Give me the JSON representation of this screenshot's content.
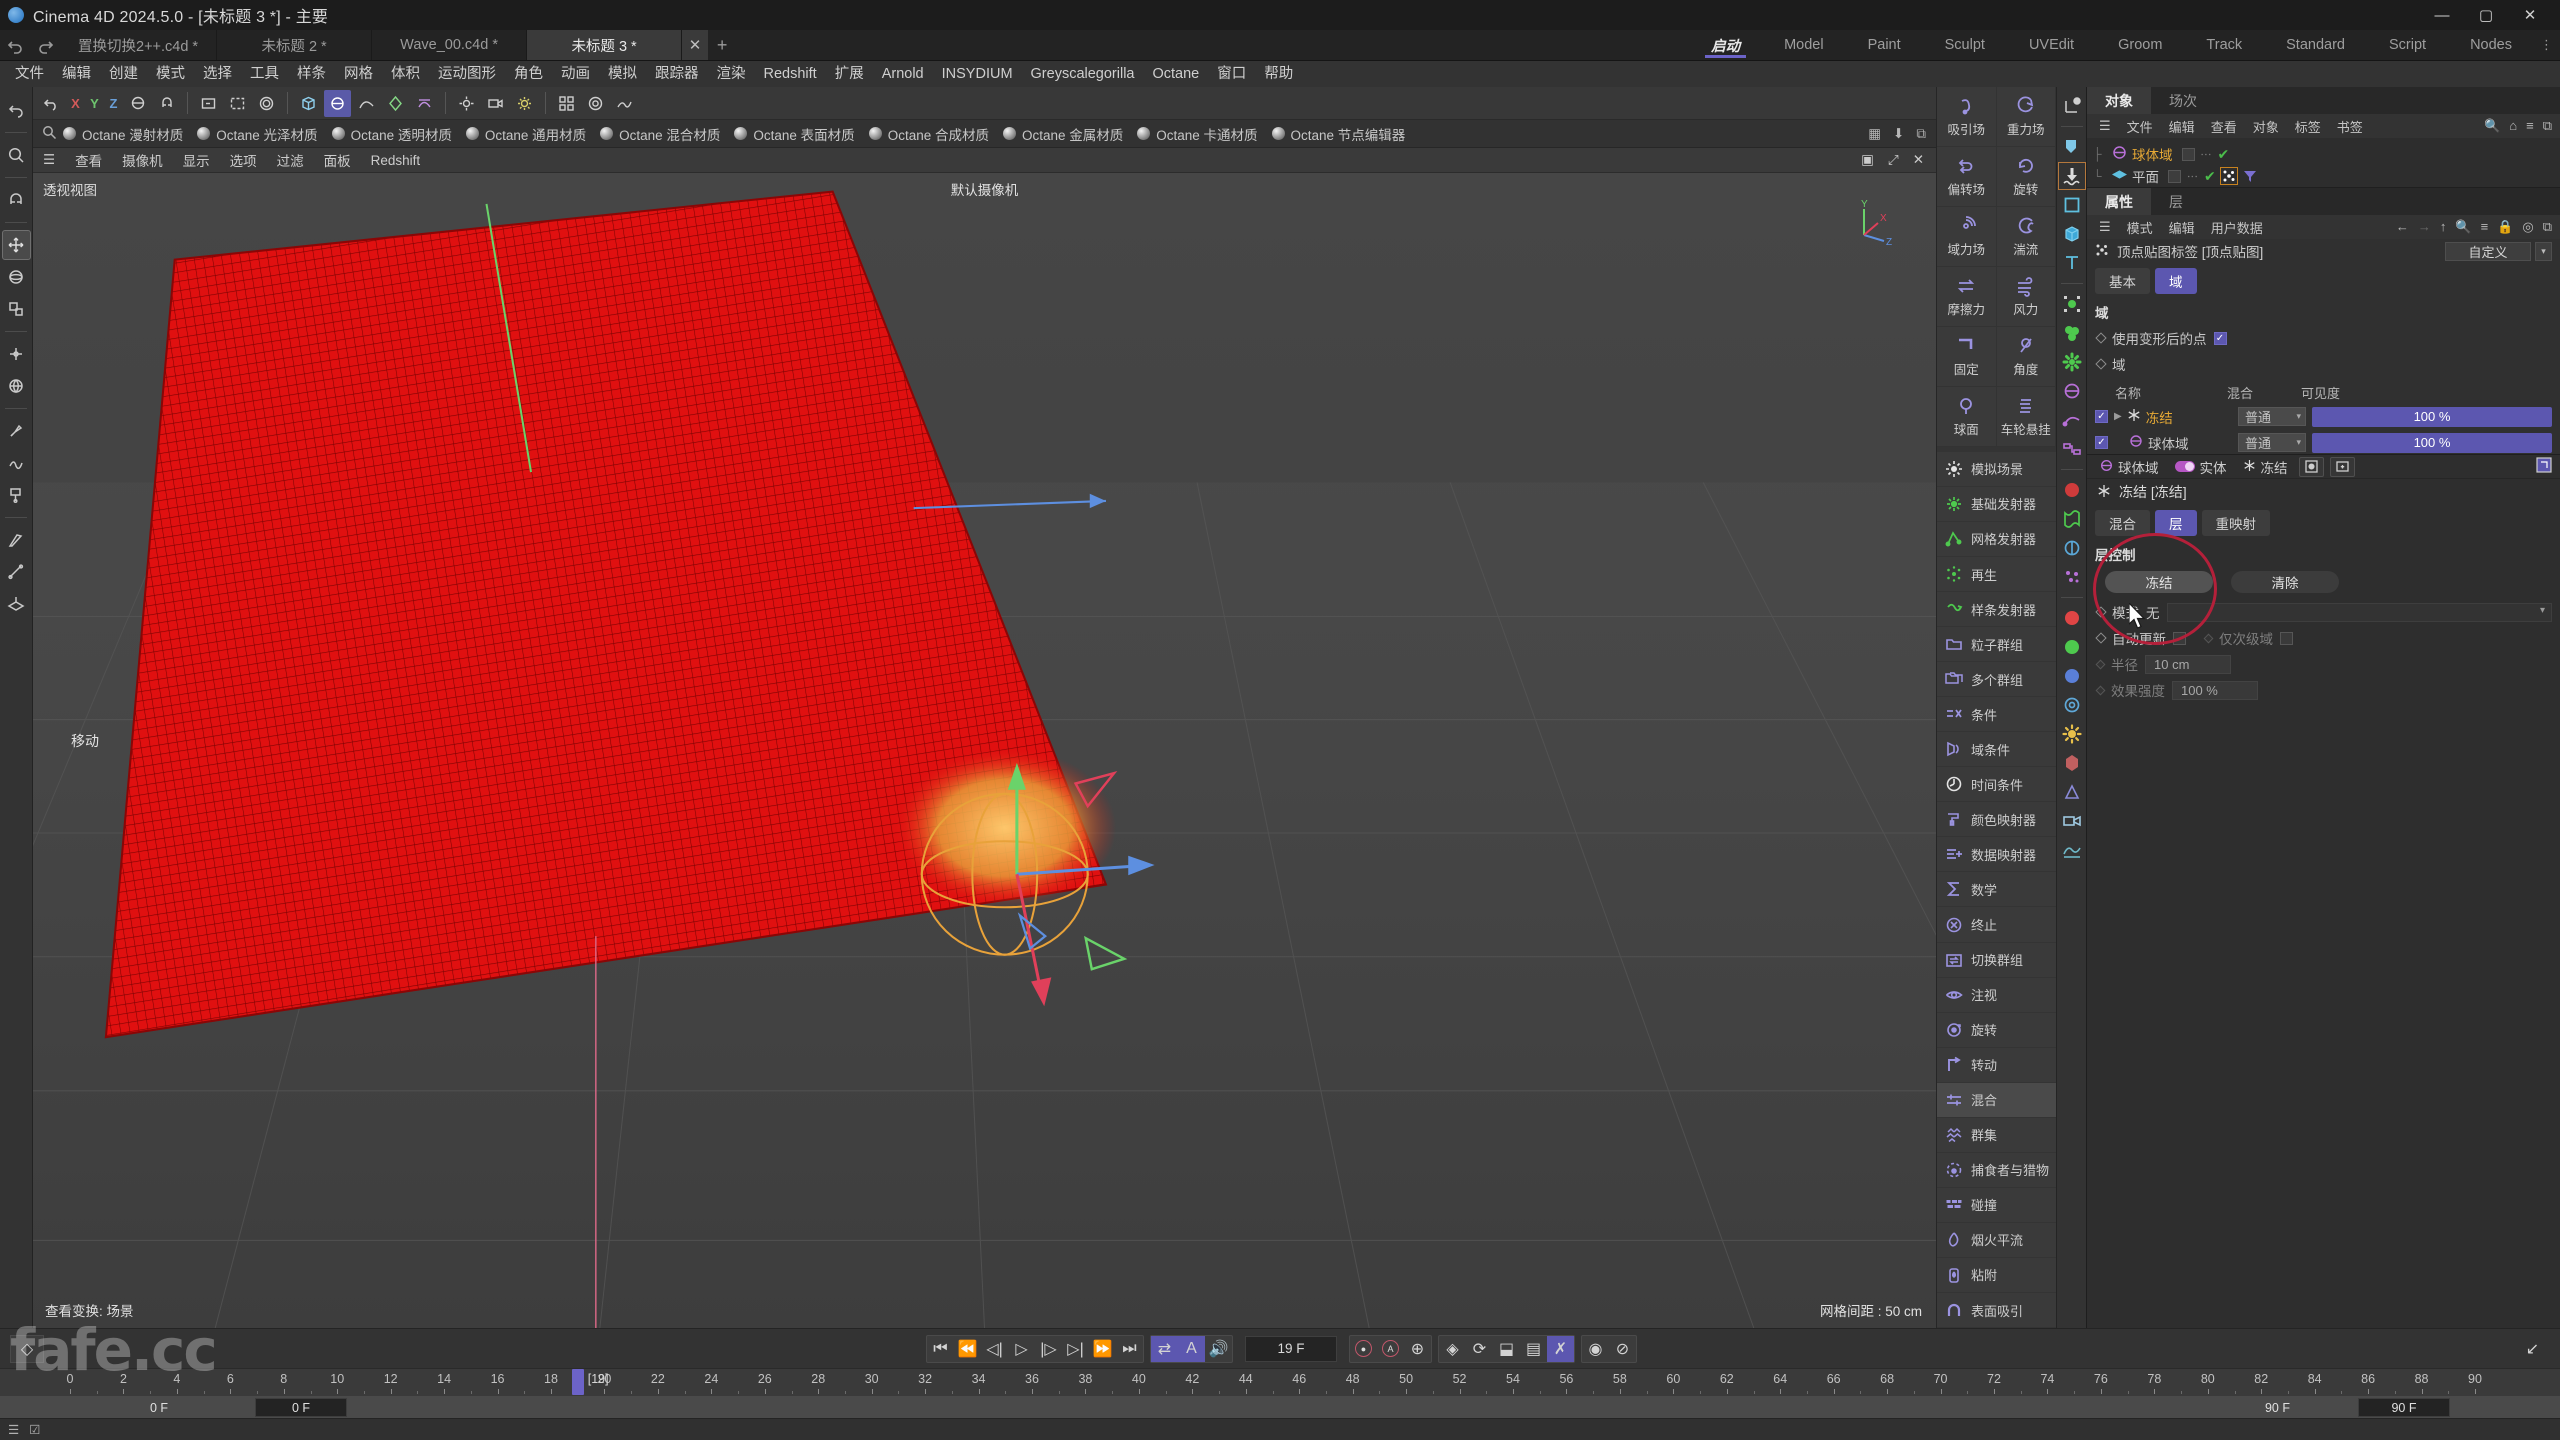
{
  "window": {
    "title": "Cinema 4D 2024.5.0 - [未标题 3 *] - 主要",
    "minimize": "—",
    "maximize": "▢",
    "close": "✕"
  },
  "doc_tabs": [
    {
      "label": "置换切换2++.c4d *",
      "active": false
    },
    {
      "label": "未标题 2 *",
      "active": false
    },
    {
      "label": "Wave_00.c4d *",
      "active": false
    },
    {
      "label": "未标题 3 *",
      "active": true
    }
  ],
  "doc_tab_close": "✕",
  "doc_tab_add": "+",
  "layout_tabs": [
    {
      "label": "启动",
      "active": true
    },
    {
      "label": "Model",
      "active": false
    },
    {
      "label": "Paint",
      "active": false
    },
    {
      "label": "Sculpt",
      "active": false
    },
    {
      "label": "UVEdit",
      "active": false
    },
    {
      "label": "Groom",
      "active": false
    },
    {
      "label": "Track",
      "active": false
    },
    {
      "label": "Standard",
      "active": false
    },
    {
      "label": "Script",
      "active": false
    },
    {
      "label": "Nodes",
      "active": false
    }
  ],
  "menubar": [
    "文件",
    "编辑",
    "创建",
    "模式",
    "选择",
    "工具",
    "样条",
    "网格",
    "体积",
    "运动图形",
    "角色",
    "动画",
    "模拟",
    "跟踪器",
    "渲染",
    "Redshift",
    "扩展",
    "Arnold",
    "INSYDIUM",
    "Greyscalegorilla",
    "Octane",
    "窗口",
    "帮助"
  ],
  "axis_buttons": [
    "X",
    "Y",
    "Z"
  ],
  "material_bar": {
    "items": [
      "Octane 漫射材质",
      "Octane 光泽材质",
      "Octane 透明材质",
      "Octane 通用材质",
      "Octane 混合材质",
      "Octane 表面材质",
      "Octane 合成材质",
      "Octane 金属材质",
      "Octane 卡通材质",
      "Octane 节点编辑器"
    ]
  },
  "viewport_menu": [
    "查看",
    "摄像机",
    "显示",
    "选项",
    "过滤",
    "面板",
    "Redshift"
  ],
  "viewport": {
    "label_topleft": "透视视图",
    "label_topcenter": "默认摄像机",
    "label_bottomleft": "查看变换: 场景",
    "grid_spacing": "网格间距 : 50 cm",
    "tool_hint": "移动",
    "axis_x": "X",
    "axis_y": "Y",
    "axis_z": "Z",
    "plane_color": "#e01010",
    "field_color": "#e8a23a"
  },
  "sim_fields": {
    "cells": [
      {
        "label": "吸引场"
      },
      {
        "label": "重力场"
      },
      {
        "label": "偏转场"
      },
      {
        "label": "旋转"
      },
      {
        "label": "域力场"
      },
      {
        "label": "湍流"
      },
      {
        "label": "摩擦力"
      },
      {
        "label": "风力"
      },
      {
        "label": "固定"
      },
      {
        "label": "角度"
      },
      {
        "label": "球面"
      },
      {
        "label": "车轮悬挂"
      }
    ]
  },
  "sim_list": [
    {
      "label": "模拟场景",
      "icon": "gear-icon",
      "color": "#e4e4e4"
    },
    {
      "label": "基础发射器",
      "icon": "emitter-icon",
      "color": "#4ec94e"
    },
    {
      "label": "网格发射器",
      "icon": "mesh-emitter-icon",
      "color": "#4ec94e"
    },
    {
      "label": "再生",
      "icon": "regen-icon",
      "color": "#4ec94e"
    },
    {
      "label": "样条发射器",
      "icon": "spline-emitter-icon",
      "color": "#4ec94e"
    },
    {
      "label": "粒子群组",
      "icon": "folder-icon",
      "color": "#9b93e0"
    },
    {
      "label": "多个群组",
      "icon": "folders-icon",
      "color": "#9b93e0"
    },
    {
      "label": "条件",
      "icon": "condition-icon",
      "color": "#9b93e0"
    },
    {
      "label": "域条件",
      "icon": "field-condition-icon",
      "color": "#9b93e0"
    },
    {
      "label": "时间条件",
      "icon": "time-condition-icon",
      "color": "#e4e4e4"
    },
    {
      "label": "颜色映射器",
      "icon": "color-mapper-icon",
      "color": "#9b93e0"
    },
    {
      "label": "数据映射器",
      "icon": "data-mapper-icon",
      "color": "#9b93e0"
    },
    {
      "label": "数学",
      "icon": "sigma-icon",
      "color": "#9b93e0"
    },
    {
      "label": "终止",
      "icon": "terminate-icon",
      "color": "#9b93e0"
    },
    {
      "label": "切换群组",
      "icon": "switch-group-icon",
      "color": "#9b93e0"
    },
    {
      "label": "注视",
      "icon": "eye-icon",
      "color": "#9b93e0"
    },
    {
      "label": "旋转",
      "icon": "rotate-icon",
      "color": "#9b93e0"
    },
    {
      "label": "转动",
      "icon": "turn-icon",
      "color": "#9b93e0"
    },
    {
      "label": "混合",
      "icon": "blend-icon",
      "color": "#9b93e0",
      "highlight": true
    },
    {
      "label": "群集",
      "icon": "flock-icon",
      "color": "#9b93e0"
    },
    {
      "label": "捕食者与猎物",
      "icon": "predator-prey-icon",
      "color": "#9b93e0"
    },
    {
      "label": "碰撞",
      "icon": "collision-icon",
      "color": "#9b93e0"
    },
    {
      "label": "烟火平流",
      "icon": "pyro-advect-icon",
      "color": "#9b93e0"
    },
    {
      "label": "粘附",
      "icon": "stick-icon",
      "color": "#9b93e0"
    },
    {
      "label": "表面吸引",
      "icon": "surface-attract-icon",
      "color": "#9b93e0"
    }
  ],
  "object_manager": {
    "tabs": [
      {
        "label": "对象",
        "active": true
      },
      {
        "label": "场次",
        "active": false
      }
    ],
    "menu": [
      "文件",
      "编辑",
      "查看",
      "对象",
      "标签",
      "书签"
    ],
    "right_icons": [
      "search-icon",
      "home-icon",
      "filter-icon",
      "popout-icon"
    ],
    "rows": [
      {
        "name": "球体域",
        "selected": true,
        "icon": "sphere-field-icon",
        "check": "✔",
        "tags": []
      },
      {
        "name": "平面",
        "selected": false,
        "icon": "plane-icon",
        "check": "✔",
        "tags": [
          "vertex-map-tag",
          "field-tag"
        ]
      }
    ]
  },
  "attributes": {
    "tabs": [
      {
        "label": "属性",
        "active": true
      },
      {
        "label": "层",
        "active": false
      }
    ],
    "menu": [
      "模式",
      "编辑",
      "用户数据"
    ],
    "right_icons": [
      "back-icon",
      "forward-icon",
      "up-icon",
      "search-icon",
      "filter-icon",
      "lock-icon",
      "target-icon",
      "popout-icon"
    ],
    "header_title": "顶点贴图标签 [顶点贴图]",
    "preset": "自定义",
    "segments": [
      {
        "label": "基本",
        "on": false
      },
      {
        "label": "域",
        "on": true
      }
    ],
    "section_title": "域",
    "use_deformed_points": {
      "label": "使用变形后的点",
      "checked": true
    },
    "field_label": "域",
    "table_headers": {
      "name": "名称",
      "blend": "混合",
      "visibility": "可见度"
    },
    "table_rows": [
      {
        "enabled": true,
        "name": "冻结",
        "icon": "freeze-icon",
        "selected": true,
        "blend": "普通",
        "visibility": "100 %",
        "expandable": true
      },
      {
        "enabled": true,
        "name": "球体域",
        "icon": "sphere-field-icon",
        "selected": false,
        "blend": "普通",
        "visibility": "100 %",
        "expandable": false
      }
    ]
  },
  "object_props": {
    "breadcrumb": [
      {
        "label": "球体域",
        "icon": "sphere-field-icon"
      },
      {
        "label": "实体",
        "icon": "toggle-pill"
      },
      {
        "label": "冻结",
        "icon": "freeze-icon"
      }
    ],
    "breadcrumb_buttons": [
      "target-icon",
      "new-folder-icon"
    ],
    "breadcrumb_right": "popout-icon",
    "title": "冻结 [冻结]",
    "title_icon": "freeze-icon",
    "segments": [
      {
        "label": "混合",
        "on": false
      },
      {
        "label": "层",
        "on": true
      },
      {
        "label": "重映射",
        "on": false
      }
    ],
    "section_title": "层控制",
    "buttons": [
      {
        "label": "冻结",
        "primary": true
      },
      {
        "label": "清除",
        "primary": false
      }
    ],
    "rows": [
      {
        "label": "模式",
        "value": "无",
        "type": "dropdown"
      },
      {
        "label": "自动更新",
        "value": "",
        "type": "checkbox",
        "checked": false,
        "extra_label": "仅次级域",
        "extra_checked": false
      },
      {
        "label": "半径",
        "value": "10 cm",
        "type": "number",
        "dim": true
      },
      {
        "label": "效果强度",
        "value": "100 %",
        "type": "number",
        "dim": true
      }
    ]
  },
  "timeline": {
    "current_frame": "19 F",
    "start_frame": "0 F",
    "preview_start": "0 F",
    "end_frame": "90 F",
    "preview_end": "90 F",
    "playhead_label": "[19]",
    "playhead_frame": 19,
    "min": 0,
    "max": 90,
    "ticks": [
      0,
      2,
      4,
      6,
      8,
      10,
      12,
      14,
      16,
      18,
      20,
      22,
      24,
      26,
      28,
      30,
      32,
      34,
      36,
      38,
      40,
      42,
      44,
      46,
      48,
      50,
      52,
      54,
      56,
      58,
      60,
      62,
      64,
      66,
      68,
      70,
      72,
      74,
      76,
      78,
      80,
      82,
      84,
      86,
      88,
      90
    ]
  },
  "transport": {
    "buttons": [
      "go-to-start",
      "prev-key",
      "prev-frame",
      "play-back",
      "play-forward",
      "next-frame",
      "next-key",
      "go-to-end"
    ],
    "toggles": [
      "loop-icon",
      "autokey-icon",
      "sound-icon"
    ],
    "record": [
      "record-icon",
      "autokey-circle-icon",
      "keyframe-selection-icon"
    ],
    "params": [
      "position-icon",
      "rotation-icon",
      "scale-icon",
      "param-icon",
      "pla-icon"
    ],
    "extra": [
      "point-level-icon",
      "dynamics-icon"
    ]
  },
  "watermark": "fafe.cc",
  "colors": {
    "accent": "#5c57b0",
    "selected_text": "#e6a935",
    "annotation": "#b4203a",
    "green_check": "#4bbd4b"
  }
}
